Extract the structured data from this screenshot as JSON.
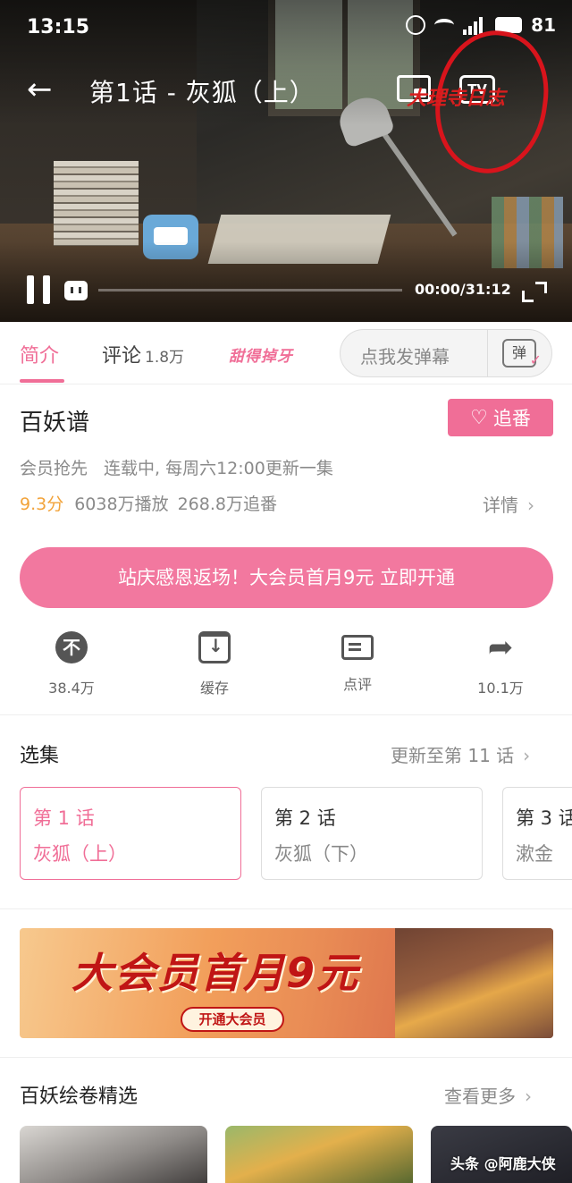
{
  "status_bar": {
    "time": "13:15",
    "network": "4G",
    "battery": "81"
  },
  "player": {
    "title": "第1话 - 灰狐（上）",
    "cast_label": "TV",
    "time_readout": "00:00/31:12",
    "progress": 0.0,
    "icons": [
      "back-arrow-icon",
      "pip-icon",
      "tv-cast-icon",
      "pause-icon",
      "danmaku-toggle-icon",
      "fullscreen-icon"
    ]
  },
  "tabs": {
    "intro": "简介",
    "comments": "评论",
    "comments_count": "1.8万",
    "promo": "甜得掉牙"
  },
  "danmaku": {
    "placeholder": "点我发弹幕",
    "send_badge": "弹"
  },
  "show": {
    "title": "百妖谱",
    "follow_label": "追番",
    "meta": [
      "会员抢先",
      "连载中, 每周六12:00更新一集"
    ],
    "score": "9.3分",
    "plays": "6038万播放",
    "followers": "268.8万追番",
    "detail_label": "详情"
  },
  "vip_banner": {
    "text": "站庆感恩返场！大会员首月9元 立即开通"
  },
  "actions": [
    {
      "label": "38.4万",
      "icon": "coin-icon"
    },
    {
      "label": "缓存",
      "icon": "cache-icon"
    },
    {
      "label": "点评",
      "icon": "review-icon"
    },
    {
      "label": "10.1万",
      "icon": "share-icon"
    }
  ],
  "episodes": {
    "title": "选集",
    "update_status": "更新至第 11 话",
    "items": [
      {
        "num": "第 1 话",
        "name": "灰狐（上）",
        "active": true
      },
      {
        "num": "第 2 话",
        "name": "灰狐（下）",
        "active": false
      },
      {
        "num": "第 3 话",
        "name": "漱金",
        "active": false
      }
    ]
  },
  "ad": {
    "headline": "大会员首月9元",
    "cta": "开通大会员",
    "art_text": "大理寺日志"
  },
  "gallery": {
    "title": "百妖绘卷精选",
    "more_label": "查看更多"
  },
  "watermark": "头条 @阿鹿大侠",
  "colors": {
    "accent_pink": "#f06e97",
    "score_gold": "#f2a33a",
    "annotation_red": "#d8141c"
  }
}
